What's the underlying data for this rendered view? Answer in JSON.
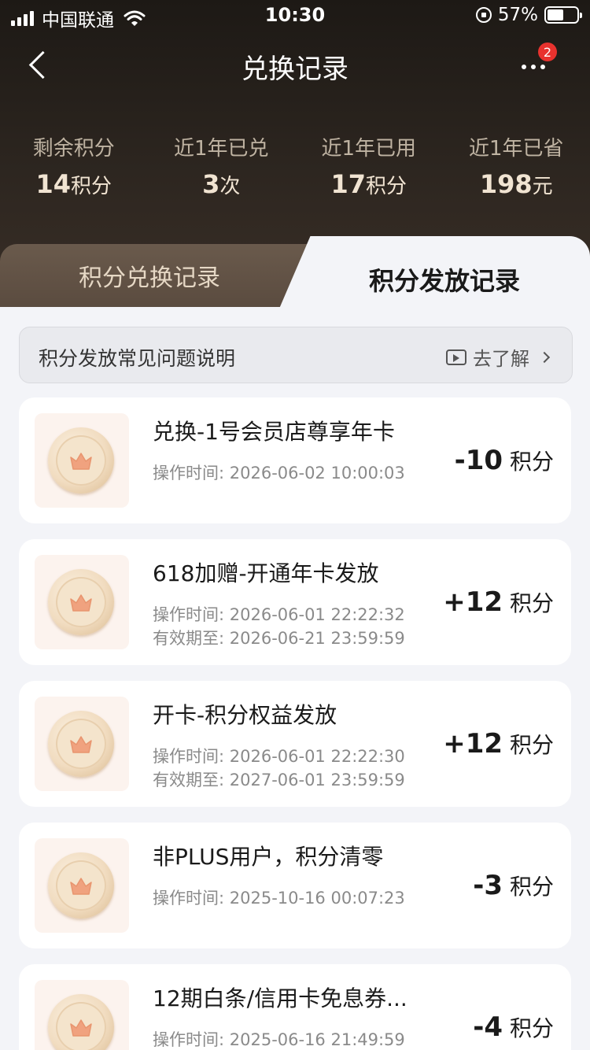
{
  "status_bar": {
    "carrier": "中国联通",
    "time": "10:30",
    "battery": "57%"
  },
  "nav": {
    "title": "兑换记录",
    "badge_count": "2"
  },
  "stats": [
    {
      "label": "剩余积分",
      "value": "14",
      "unit": "积分"
    },
    {
      "label": "近1年已兑",
      "value": "3",
      "unit": "次"
    },
    {
      "label": "近1年已用",
      "value": "17",
      "unit": "积分"
    },
    {
      "label": "近1年已省",
      "value": "198",
      "unit": "元"
    }
  ],
  "tabs": {
    "exchange": "积分兑换记录",
    "issue": "积分发放记录"
  },
  "faq": {
    "text": "积分发放常见问题说明",
    "link": "去了解"
  },
  "records": [
    {
      "title": "兑换-1号会员店尊享年卡",
      "op_time": "操作时间: 2026-06-02 10:00:03",
      "expire": "",
      "amount": "-10",
      "unit": "积分"
    },
    {
      "title": "618加赠-开通年卡发放",
      "op_time": "操作时间: 2026-06-01 22:22:32",
      "expire": "有效期至: 2026-06-21 23:59:59",
      "amount": "+12",
      "unit": "积分"
    },
    {
      "title": "开卡-积分权益发放",
      "op_time": "操作时间: 2026-06-01 22:22:30",
      "expire": "有效期至: 2027-06-01 23:59:59",
      "amount": "+12",
      "unit": "积分"
    },
    {
      "title": "非PLUS用户，积分清零",
      "op_time": "操作时间: 2025-10-16 00:07:23",
      "expire": "",
      "amount": "-3",
      "unit": "积分"
    },
    {
      "title": "12期白条/信用卡免息券...",
      "op_time": "操作时间: 2025-06-16 21:49:59",
      "expire": "",
      "amount": "-4",
      "unit": "积分"
    }
  ],
  "colors": {
    "header_dark": "#1d1915",
    "tab_inactive": "#5a4b3f",
    "badge": "#e8322e",
    "coin_bg": "#fcf3ee",
    "crown": "#f0a27f"
  }
}
